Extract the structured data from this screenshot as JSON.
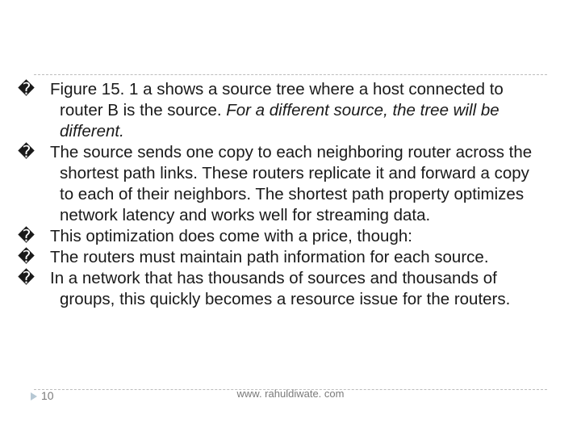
{
  "bullets": {
    "b1a": "Figure 15. 1 a shows a source tree where a host connected to router B is the source. ",
    "b1b": "For a different source, the tree will be different.",
    "b2": "The source sends one copy to each neighboring router across the shortest path links. These routers replicate it and forward a copy to each of their neighbors. The shortest path property optimizes network latency and works well for streaming data.",
    "b3": "This optimization does come with a price, though:",
    "b4": "The routers must maintain path information for each source.",
    "b5": "In a network that has thousands of sources and thousands of groups, this quickly becomes a resource issue for the routers."
  },
  "glyph": "�",
  "footer": {
    "num": "10",
    "url": "www. rahuldiwate. com"
  }
}
